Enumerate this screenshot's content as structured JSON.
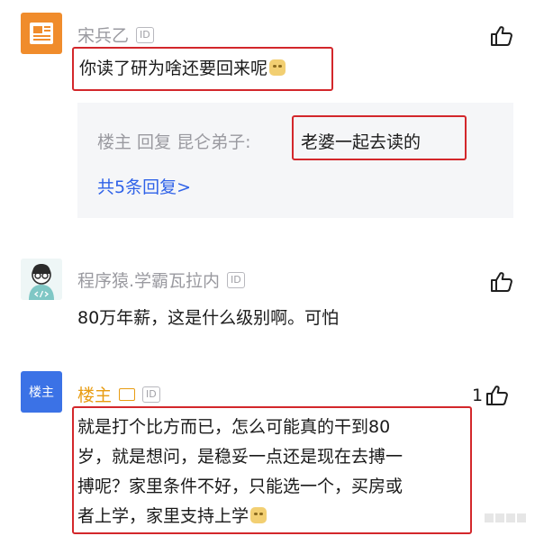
{
  "comments": [
    {
      "username": "宋兵乙",
      "id_badge": "ID",
      "text": "你读了研为啥还要回来呢",
      "reply_box": {
        "prefix": "楼主 回复 昆仑弟子:",
        "text": "老婆一起去读的",
        "more_link": "共5条回复>"
      }
    },
    {
      "username": "程序猿.学霸瓦拉内",
      "id_badge": "ID",
      "text": "80万年薪，这是什么级别啊。可怕"
    },
    {
      "username": "楼主",
      "avatar_label": "楼主",
      "id_badge": "ID",
      "like_count": "1",
      "text_lines": [
        "就是打个比方而已，怎么可能真的干到80",
        "岁，就是想问，是稳妥一点还是现在去搏一",
        "搏呢？家里条件不好，只能选一个，买房或",
        "者上学，家里支持上学"
      ]
    }
  ],
  "colors": {
    "highlight_box": "#d3272b",
    "link_blue": "#2f62e8",
    "op_name_orange": "#e89c12",
    "avatar_orange": "#f08c2c",
    "avatar_blue": "#3b72e6",
    "reply_bg": "#f5f6f8"
  },
  "icons": [
    "document-icon",
    "coder-avatar-icon",
    "thumbs-up-icon",
    "id-badge-icon",
    "image-badge-icon",
    "emoji-icon"
  ],
  "watermark": "&nbsp;"
}
